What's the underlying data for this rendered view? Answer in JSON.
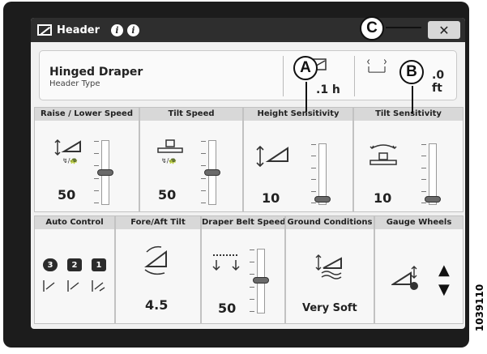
{
  "window": {
    "title": "Header",
    "close_symbol": "✕",
    "title_icon": "header-icon",
    "info_icons": [
      "info-icon",
      "info-icon"
    ]
  },
  "header_type": {
    "name": "Hinged Draper",
    "label": "Header Type"
  },
  "summary": {
    "hours_value": ".1 h",
    "width_value": ".0 ft"
  },
  "callouts": {
    "a": "A",
    "b": "B",
    "c": "C"
  },
  "tiles_top": [
    {
      "label": "Raise / Lower Speed",
      "value": "50",
      "level": 0.55
    },
    {
      "label": "Tilt Speed",
      "value": "50",
      "level": 0.55
    },
    {
      "label": "Height Sensitivity",
      "value": "10",
      "level": 0.1
    },
    {
      "label": "Tilt Sensitivity",
      "value": "10",
      "level": 0.1
    }
  ],
  "tiles_bottom": {
    "auto_control": {
      "label": "Auto Control",
      "modes": [
        "3",
        "2",
        "1"
      ]
    },
    "fore_aft_tilt": {
      "label": "Fore/Aft Tilt",
      "value": "4.5"
    },
    "draper_belt_speed": {
      "label": "Draper Belt Speed",
      "value": "50",
      "level": 0.5
    },
    "ground_conditions": {
      "label": "Ground Conditions",
      "value": "Very Soft"
    },
    "gauge_wheels": {
      "label": "Gauge Wheels",
      "up": "▲",
      "down": "▼"
    }
  },
  "figure_id": "1039110",
  "colors": {
    "bezel": "#1c1c1c",
    "titlebar": "#2e2e2e",
    "tile_header": "#d8d8d8"
  }
}
